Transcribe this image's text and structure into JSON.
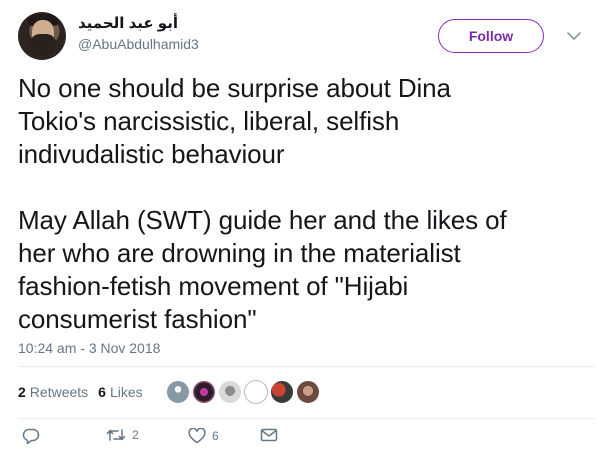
{
  "user": {
    "display_name": "أبو عبد الحميد",
    "handle": "@AbuAbdulhamid3"
  },
  "follow_label": "Follow",
  "tweet": {
    "text": "No one should be surprise about Dina\nTokio's narcissistic, liberal, selfish\nindivudalistic behaviour\n\nMay Allah (SWT) guide her and the likes of\nher who are drowning in the materialist\nfashion-fetish movement of \"Hijabi\nconsumerist fashion\"",
    "timestamp": "10:24 am - 3 Nov 2018"
  },
  "stats": {
    "retweets_count": "2",
    "retweets_label": "Retweets",
    "likes_count": "6",
    "likes_label": "Likes"
  },
  "actions": {
    "reply_count": "",
    "retweet_count": "2",
    "like_count": "6"
  },
  "colors": {
    "accent": "#7b2aa6",
    "muted": "#657786",
    "text": "#14171a"
  }
}
